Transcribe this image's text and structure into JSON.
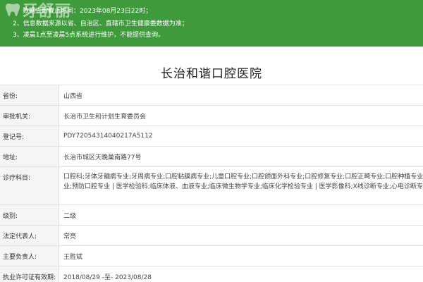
{
  "banner": {
    "watermark_text": "牙舒丽",
    "line1": "数据查询截止时间：2023年08月23日22时；",
    "line2": "2、信息数据来源以省、自治区、直辖市卫生健康委数据为准；",
    "line3": "3、凌晨1点至凌晨5点系统进行维护，不能提供查询。",
    "bg_color": "#3f9a3c"
  },
  "hospital": {
    "name": "长治和谐口腔医院"
  },
  "fields": [
    {
      "label": "省份:",
      "value": "山西省"
    },
    {
      "label": "审批机关:",
      "value": "长治市卫生和计划生育委员会"
    },
    {
      "label": "登记号:",
      "value": "PDY72054314040217A5112"
    },
    {
      "label": "地址:",
      "value": "长治市城区天晚巢南路77号"
    },
    {
      "label": "诊疗科目:",
      "value_lines": [
        "口腔科;牙体牙髓病专业;牙周病专业;口腔粘膜病专业;儿童口腔专业;口腔颌面外科专业;口腔修复专业;口腔正畸专业;口腔种植专业;口腔颌面医学影像专业",
        "业;预防口腔专业 | 医学检验科;临床体液、血液专业;临床微生物学专业;临床化学检验专业 | 医学影像科;X线诊断专业;心电诊断专业******"
      ]
    },
    {
      "label": "级别:",
      "value": "二级"
    },
    {
      "label": "法定代表人:",
      "value": "常亮"
    },
    {
      "label": "主要负责人:",
      "value": "王胜斌"
    },
    {
      "label": "执业许可证有效期:",
      "value": "2018/08/29 -至- 2023/08/28"
    }
  ]
}
